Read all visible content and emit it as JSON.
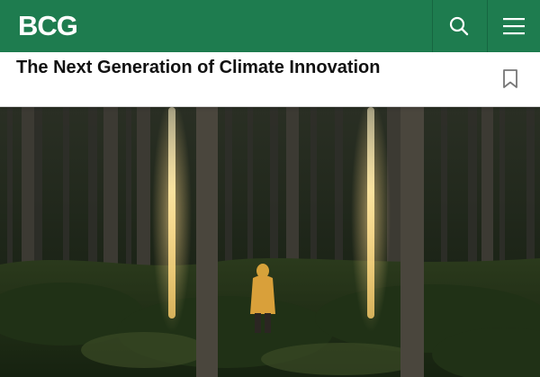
{
  "header": {
    "logo_text": "BCG",
    "brand_color": "#1e7c4f",
    "search_icon": "search-icon",
    "menu_icon": "hamburger-menu-icon"
  },
  "article": {
    "title": "The Next Generation of Climate Innovation",
    "bookmark_icon": "bookmark-icon"
  },
  "hero_image": {
    "scene": "forest-with-glowing-light-beams"
  }
}
